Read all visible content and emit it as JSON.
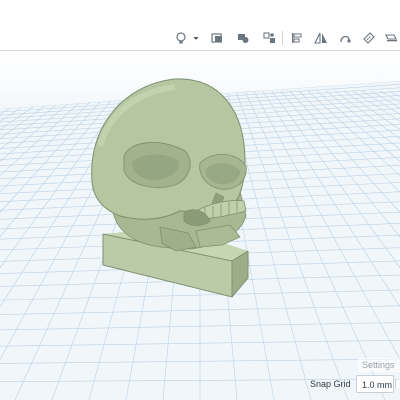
{
  "toolbar": {
    "tools": [
      {
        "icon": "lightbulb-icon"
      },
      {
        "icon": "dropdown-caret-icon"
      },
      {
        "icon": "show-all-icon"
      },
      {
        "icon": "group-icon"
      },
      {
        "icon": "ungroup-icon"
      },
      {
        "icon": "align-icon"
      },
      {
        "icon": "mirror-icon"
      },
      {
        "icon": "cruise-icon"
      },
      {
        "icon": "ruler-icon"
      },
      {
        "icon": "notes-icon"
      }
    ]
  },
  "viewport": {
    "settings_label": "Settings",
    "snap_grid_label": "Snap Grid",
    "snap_grid_value": "1.0 mm",
    "model_color": "#b6c7a1",
    "grid_color": "#bcd2e6"
  }
}
